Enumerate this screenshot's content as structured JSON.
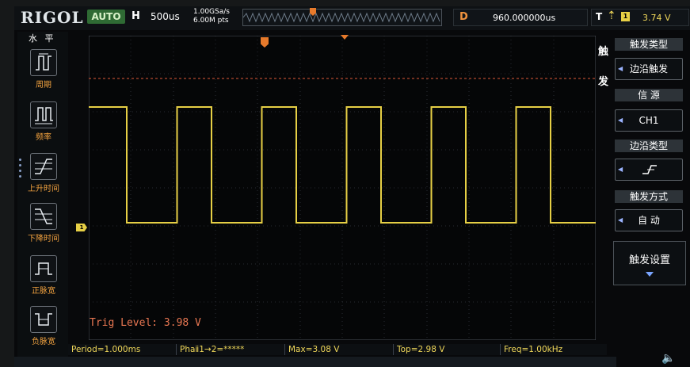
{
  "header": {
    "brand": "RIGOL",
    "run_status": "AUTO",
    "h_label": "H",
    "timebase": "500us",
    "sample_rate": "1.00GSa/s",
    "memory_depth": "6.00M pts",
    "delay_label": "D",
    "delay_value": "960.000000us",
    "trigger_label": "T",
    "trigger_channel": "1",
    "trigger_level": "3.74 V"
  },
  "left_menu": {
    "title": "水 平",
    "items": [
      {
        "label": "周期",
        "icon": "period-icon"
      },
      {
        "label": "频率",
        "icon": "frequency-icon"
      },
      {
        "label": "上升时间",
        "icon": "rise-time-icon"
      },
      {
        "label": "下降时间",
        "icon": "fall-time-icon"
      },
      {
        "label": "正脉宽",
        "icon": "positive-width-icon"
      },
      {
        "label": "负脉宽",
        "icon": "negative-width-icon"
      }
    ]
  },
  "right_menu": {
    "side_title_1": "触",
    "side_title_2": "发",
    "trigger_type_header": "触发类型",
    "trigger_type_value": "边沿触发",
    "source_header": "信 源",
    "source_value": "CH1",
    "edge_type_header": "边沿类型",
    "trigger_mode_header": "触发方式",
    "trigger_mode_value": "自 动",
    "trigger_setup_label": "触发设置"
  },
  "display": {
    "trig_level_text": "Trig Level: 3.98 V",
    "channel_marker": "1"
  },
  "measurements": [
    "Period=1.000ms",
    "Phaⅱ1→2=*****",
    "Max=3.08 V",
    "Top=2.98 V",
    "Freq=1.00kHz"
  ],
  "colors": {
    "ch1": "#e6cf45",
    "trigger": "#e77a2b",
    "menu_label": "#f2a23f",
    "run_badge": "#2f6b34"
  }
}
